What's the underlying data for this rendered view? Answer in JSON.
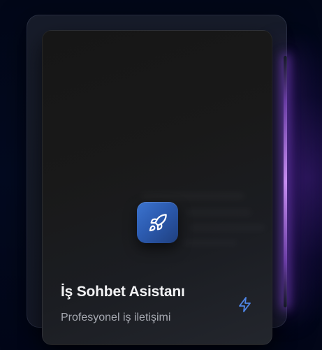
{
  "card": {
    "title": "İş Sohbet Asistanı",
    "subtitle": "Profesyonel iş iletişimi",
    "app_icon": "rocket-icon",
    "action_icon": "lightning-bolt-icon"
  },
  "colors": {
    "background": "#030a20",
    "glow": "#b07cf5",
    "icon_gradient_start": "#3c74cf",
    "icon_gradient_end": "#1f3f7e",
    "accent_bolt": "#4f86e8",
    "title": "#f3f3f5",
    "subtitle": "#a5a8b0"
  }
}
